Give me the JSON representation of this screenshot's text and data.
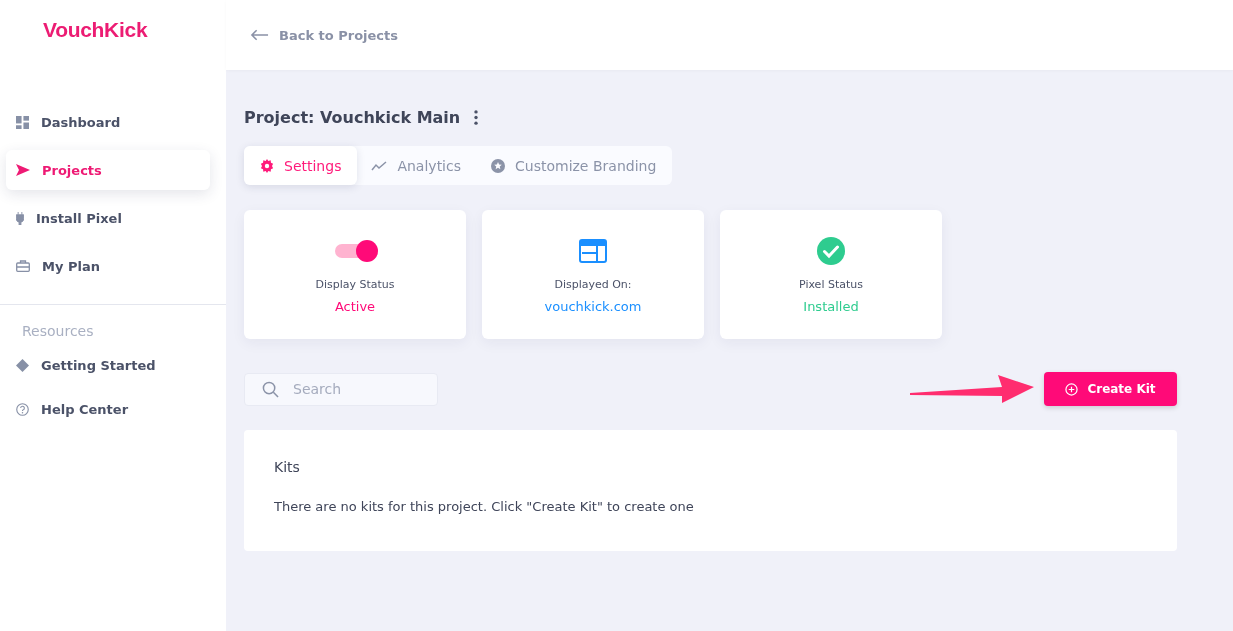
{
  "logo": "VouchKick",
  "nav": [
    {
      "label": "Dashboard",
      "kind": "grid",
      "selected": false
    },
    {
      "label": "Projects",
      "kind": "send",
      "selected": true
    },
    {
      "label": "Install Pixel",
      "kind": "plug",
      "selected": false
    },
    {
      "label": "My Plan",
      "kind": "briefcase",
      "selected": false
    }
  ],
  "resources": {
    "heading": "Resources",
    "items": [
      {
        "label": "Getting Started",
        "kind": "diamond",
        "selected": false
      },
      {
        "label": "Help Center",
        "kind": "help",
        "selected": false
      }
    ]
  },
  "back_link": "Back to Projects",
  "project_title": "Project: Vouchkick Main",
  "tabs": [
    {
      "label": "Settings",
      "kind": "gear",
      "selected": true
    },
    {
      "label": "Analytics",
      "kind": "chart",
      "selected": false
    },
    {
      "label": "Customize Branding",
      "kind": "star",
      "selected": false
    }
  ],
  "cards": [
    {
      "kind": "toggle",
      "on": true,
      "label": "Display Status",
      "value": "Active",
      "color": "#ff0a78"
    },
    {
      "kind": "site",
      "label": "Displayed On:",
      "value": "vouchkick.com",
      "color": "#1a8fff"
    },
    {
      "kind": "check",
      "label": "Pixel Status",
      "value": "Installed",
      "color": "#2ecc8f"
    }
  ],
  "search": {
    "placeholder": "Search"
  },
  "create_button": "Create Kit",
  "kits": {
    "title": "Kits",
    "message": "There are no kits for this project. Click \"Create Kit\" to create one"
  }
}
